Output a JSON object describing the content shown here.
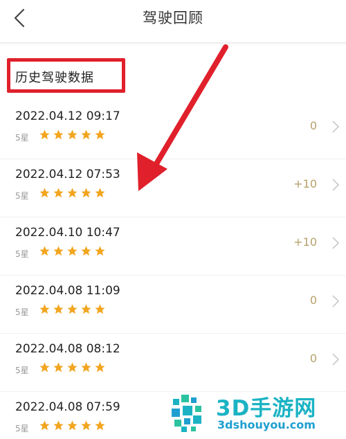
{
  "header": {
    "title": "驾驶回顾",
    "back_icon": "chevron-left-icon"
  },
  "section": {
    "title": "历史驾驶数据",
    "highlight_color": "#e0202b"
  },
  "records": [
    {
      "datetime": "2022.04.12 09:17",
      "rating_label": "5星",
      "stars": 5,
      "points": "0"
    },
    {
      "datetime": "2022.04.12 07:53",
      "rating_label": "5星",
      "stars": 5,
      "points": "+10"
    },
    {
      "datetime": "2022.04.10 10:47",
      "rating_label": "5星",
      "stars": 5,
      "points": "+10"
    },
    {
      "datetime": "2022.04.08 11:09",
      "rating_label": "5星",
      "stars": 5,
      "points": "0"
    },
    {
      "datetime": "2022.04.08 08:12",
      "rating_label": "5星",
      "stars": 5,
      "points": "0"
    },
    {
      "datetime": "2022.04.08 07:59",
      "rating_label": "5星",
      "stars": 5,
      "points": ""
    }
  ],
  "colors": {
    "star": "#f2a51f",
    "points": "#b6a06b",
    "annotation": "#e0202b"
  },
  "watermark": {
    "title": "3D手游网",
    "url": "3dshouyou.com"
  }
}
